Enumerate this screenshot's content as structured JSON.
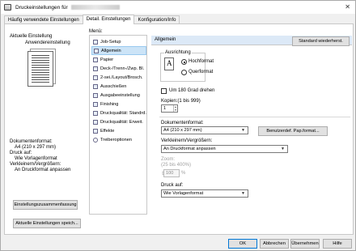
{
  "window": {
    "title": "Druckeinstellungen für"
  },
  "tabs": [
    {
      "label": "Häufig verwendete Einstellungen"
    },
    {
      "label": "Detail. Einstellungen"
    },
    {
      "label": "Konfiguration/Info"
    }
  ],
  "left": {
    "current_setting_label": "Aktuelle Einstellung",
    "user_setting_label": "Anwendereinstellung",
    "doc_format_label": "Dokumentenformat:",
    "doc_format_value": "A4 (210 x 297 mm)",
    "print_on_label": "Druck auf:",
    "print_on_value": "Wie Vorlagenformat",
    "scale_label": "Verkleinern/Vergrößern:",
    "scale_value": "An Druckformat anpassen",
    "summary_button": "Einstellungszusammenfassung",
    "save_button": "Aktuelle Einstellungen speich..."
  },
  "menu": {
    "label": "Menü:",
    "items": [
      {
        "label": "Job-Setup"
      },
      {
        "label": "Allgemein"
      },
      {
        "label": "Papier"
      },
      {
        "label": "Deck-/Trenn-/Zwp. Bl."
      },
      {
        "label": "2-sei./Layout/Brosch."
      },
      {
        "label": "Ausschießen"
      },
      {
        "label": "Ausgabeeinstellung"
      },
      {
        "label": "Finishing"
      },
      {
        "label": "Druckqualität: Standrd."
      },
      {
        "label": "Druckqualität: Erweit."
      },
      {
        "label": "Effekte"
      },
      {
        "label": "Treiberoptionen"
      }
    ]
  },
  "panel": {
    "title": "Allgemein",
    "restore_button": "Standard wiederherst.",
    "orientation_label": "Ausrichtung",
    "portrait": "Hochformat",
    "landscape": "Querformat",
    "rotate_label": "Um 180 Grad drehen",
    "copies_label": "Kopien:(1 bis 999)",
    "copies_value": "1",
    "doc_format_label": "Dokumentenformat:",
    "doc_format_value": "A4 (210 x 297 mm)",
    "custom_paper_button": "Benutzerdef. Pap.format...",
    "scale_label": "Verkleinern/Vergrößern:",
    "scale_value": "An Druckformat anpassen",
    "zoom_label": "Zoom:",
    "zoom_range": "(25 bis 400%)",
    "zoom_value": "100",
    "print_on_label": "Druck auf:",
    "print_on_value": "Wie Vorlagenformat"
  },
  "buttons": {
    "ok": "OK",
    "cancel": "Abbrechen",
    "apply": "Übernehmen",
    "help": "Hilfe"
  }
}
